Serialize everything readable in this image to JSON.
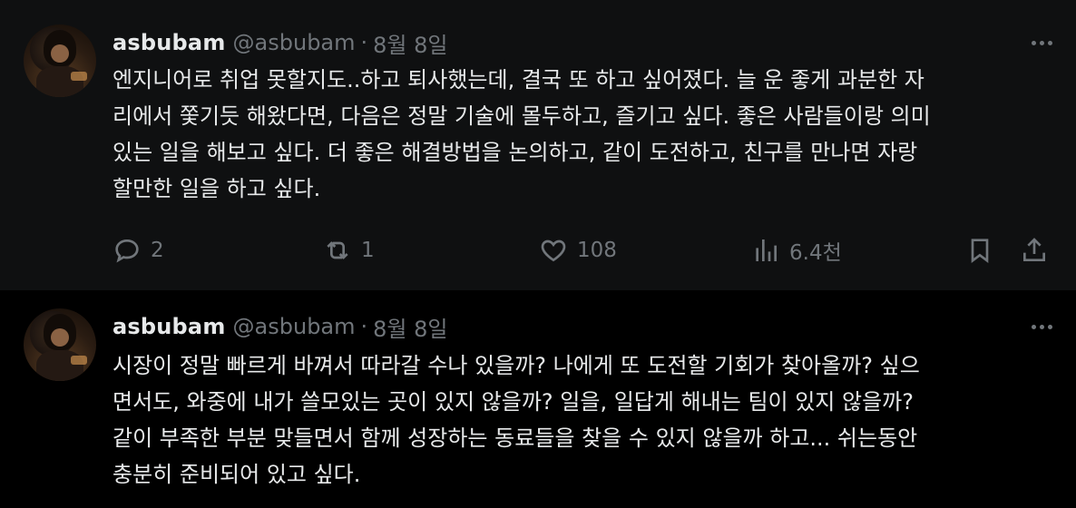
{
  "tweets": [
    {
      "name": "asbubam",
      "handle": "@asbubam",
      "separator": "·",
      "date": "8월 8일",
      "text": "엔지니어로 취업 못할지도..하고 퇴사했는데, 결국 또 하고 싶어졌다. 늘 운 좋게 과분한 자\n리에서 쫓기듯 해왔다면, 다음은 정말 기술에 몰두하고, 즐기고 싶다. 좋은 사람들이랑 의미\n있는 일을 해보고 싶다. 더 좋은 해결방법을 논의하고, 같이 도전하고, 친구를 만나면 자랑\n할만한 일을 하고 싶다.",
      "stats": {
        "replies": "2",
        "retweets": "1",
        "likes": "108",
        "views": "6.4천"
      }
    },
    {
      "name": "asbubam",
      "handle": "@asbubam",
      "separator": "·",
      "date": "8월 8일",
      "text": "시장이 정말 빠르게 바껴서 따라갈 수나 있을까? 나에게 또 도전할 기회가 찾아올까? 싶으\n면서도, 와중에 내가 쓸모있는 곳이 있지 않을까? 일을, 일답게 해내는 팀이 있지 않을까?\n같이 부족한 부분 맞들면서 함께 성장하는 동료들을 찾을 수 있지 않을까 하고... 쉬는동안\n충분히 준비되어 있고 싶다."
    }
  ],
  "icons": {
    "reply": "reply-icon",
    "retweet": "retweet-icon",
    "like": "heart-icon",
    "views": "views-icon",
    "bookmark": "bookmark-icon",
    "share": "share-icon",
    "more": "more-icon"
  },
  "colors": {
    "background": "#000000",
    "text": "#e7e9ea",
    "muted": "#71767b",
    "thread_line": "#333639"
  }
}
